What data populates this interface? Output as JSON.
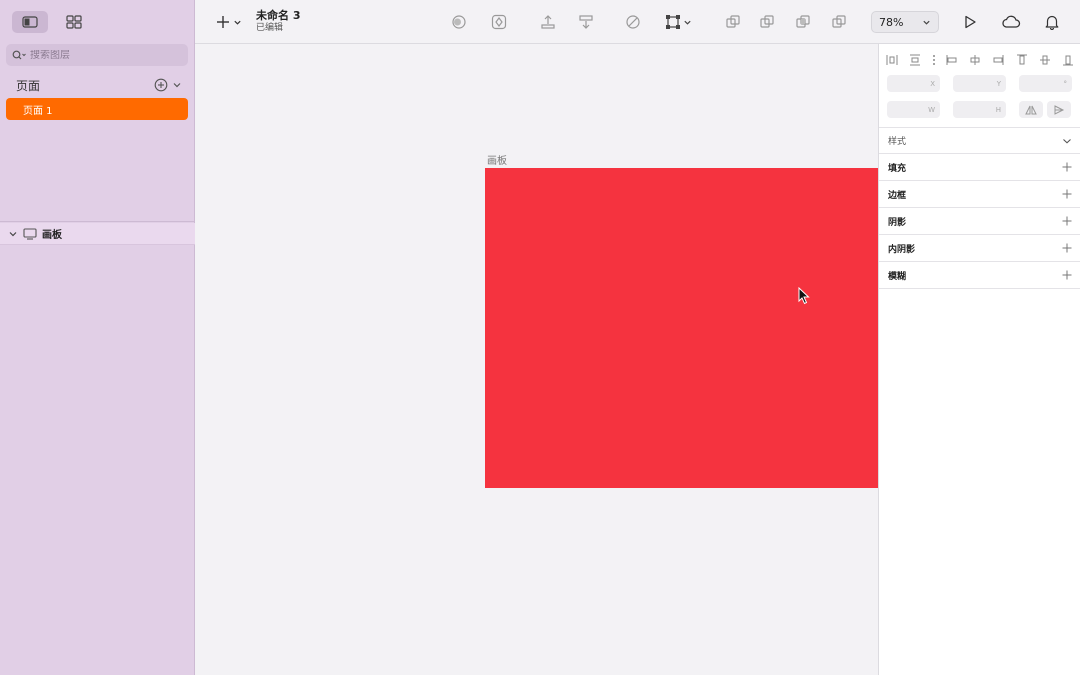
{
  "sidebar": {
    "search_placeholder": "搜索图层",
    "pages_label": "页面",
    "pages": [
      {
        "label": "页面 1"
      }
    ],
    "layers": [
      {
        "label": "画板"
      }
    ]
  },
  "toolbar": {
    "doc_title": "未命名 3",
    "doc_status": "已编辑",
    "zoom": "78%"
  },
  "canvas": {
    "artboard_label": "画板",
    "artboard_color": "#f5333f"
  },
  "inspector": {
    "fields": {
      "x": "X",
      "y": "Y",
      "rotation": "°",
      "w": "W",
      "h": "H"
    },
    "style_label": "样式",
    "sections": [
      {
        "label": "填充"
      },
      {
        "label": "边框"
      },
      {
        "label": "阴影"
      },
      {
        "label": "内阴影"
      },
      {
        "label": "模糊"
      }
    ]
  },
  "colors": {
    "sidebar_bg": "#e1cfe6",
    "accent": "#ff6a00",
    "artboard": "#f5333f"
  }
}
